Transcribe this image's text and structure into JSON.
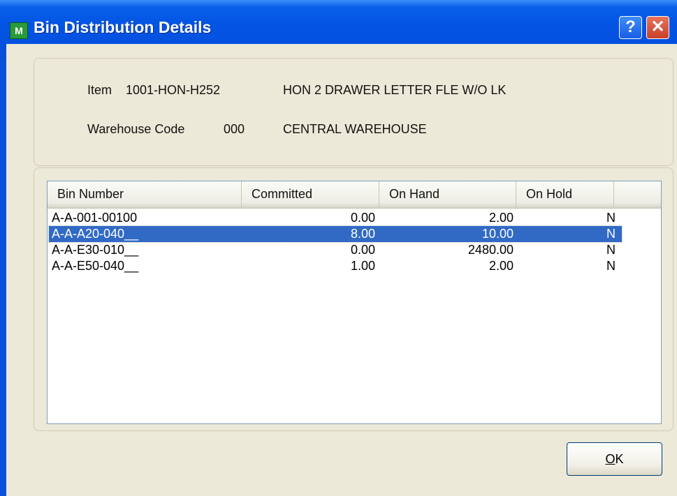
{
  "window": {
    "title": "Bin Distribution Details",
    "icon_text": "M",
    "help_label": "?",
    "close_label": "✕"
  },
  "info": {
    "item_label": "Item",
    "item_code": "1001-HON-H252",
    "item_description": "HON 2 DRAWER LETTER FLE W/O LK",
    "warehouse_label": "Warehouse Code",
    "warehouse_code": "000",
    "warehouse_description": "CENTRAL WAREHOUSE"
  },
  "table": {
    "columns": [
      "Bin Number",
      "Committed",
      "On Hand",
      "On Hold"
    ],
    "rows": [
      {
        "bin": "A-A-001-00100",
        "committed": "0.00",
        "on_hand": "2.00",
        "on_hold": "N"
      },
      {
        "bin": "A-A-A20-040__",
        "committed": "8.00",
        "on_hand": "10.00",
        "on_hold": "N"
      },
      {
        "bin": "A-A-E30-010__",
        "committed": "0.00",
        "on_hand": "2480.00",
        "on_hold": "N"
      },
      {
        "bin": "A-A-E50-040__",
        "committed": "1.00",
        "on_hand": "2.00",
        "on_hold": "N"
      }
    ],
    "selected_row": 2
  },
  "buttons": {
    "ok_underlined": "O",
    "ok_rest": "K"
  },
  "colors": {
    "titlebar": "#0354e3",
    "selection": "#316ac5",
    "dialog_bg": "#ece9d8"
  }
}
